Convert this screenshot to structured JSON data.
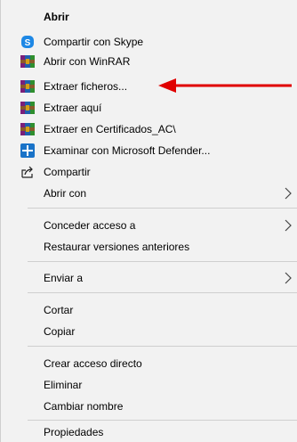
{
  "menu": {
    "items": [
      {
        "label": "Abrir",
        "icon": "none"
      },
      {
        "label": "Compartir con Skype",
        "icon": "skype-icon"
      },
      {
        "label": "Abrir con WinRAR",
        "icon": "winrar-icon"
      },
      {
        "label": "Extraer ficheros...",
        "icon": "winrar-icon"
      },
      {
        "label": "Extraer aquí",
        "icon": "winrar-icon"
      },
      {
        "label": "Extraer en Certificados_AC\\",
        "icon": "winrar-icon"
      },
      {
        "label": "Examinar con Microsoft Defender...",
        "icon": "defender-shield-icon"
      },
      {
        "label": "Compartir",
        "icon": "share-icon"
      },
      {
        "label": "Abrir con",
        "icon": "none"
      },
      {
        "label": "Conceder acceso a",
        "icon": "none"
      },
      {
        "label": "Restaurar versiones anteriores",
        "icon": "none"
      },
      {
        "label": "Enviar a",
        "icon": "none"
      },
      {
        "label": "Cortar",
        "icon": "none"
      },
      {
        "label": "Copiar",
        "icon": "none"
      },
      {
        "label": "Crear acceso directo",
        "icon": "none"
      },
      {
        "label": "Eliminar",
        "icon": "none"
      },
      {
        "label": "Cambiar nombre",
        "icon": "none"
      },
      {
        "label": "Propiedades",
        "icon": "none"
      }
    ]
  },
  "colors": {
    "menu_bg": "#f2f2f2",
    "separator": "#cfcfcf",
    "annotation_arrow": "#e00000",
    "skype_blue": "#1e88e5",
    "defender_blue": "#1a73c8"
  }
}
